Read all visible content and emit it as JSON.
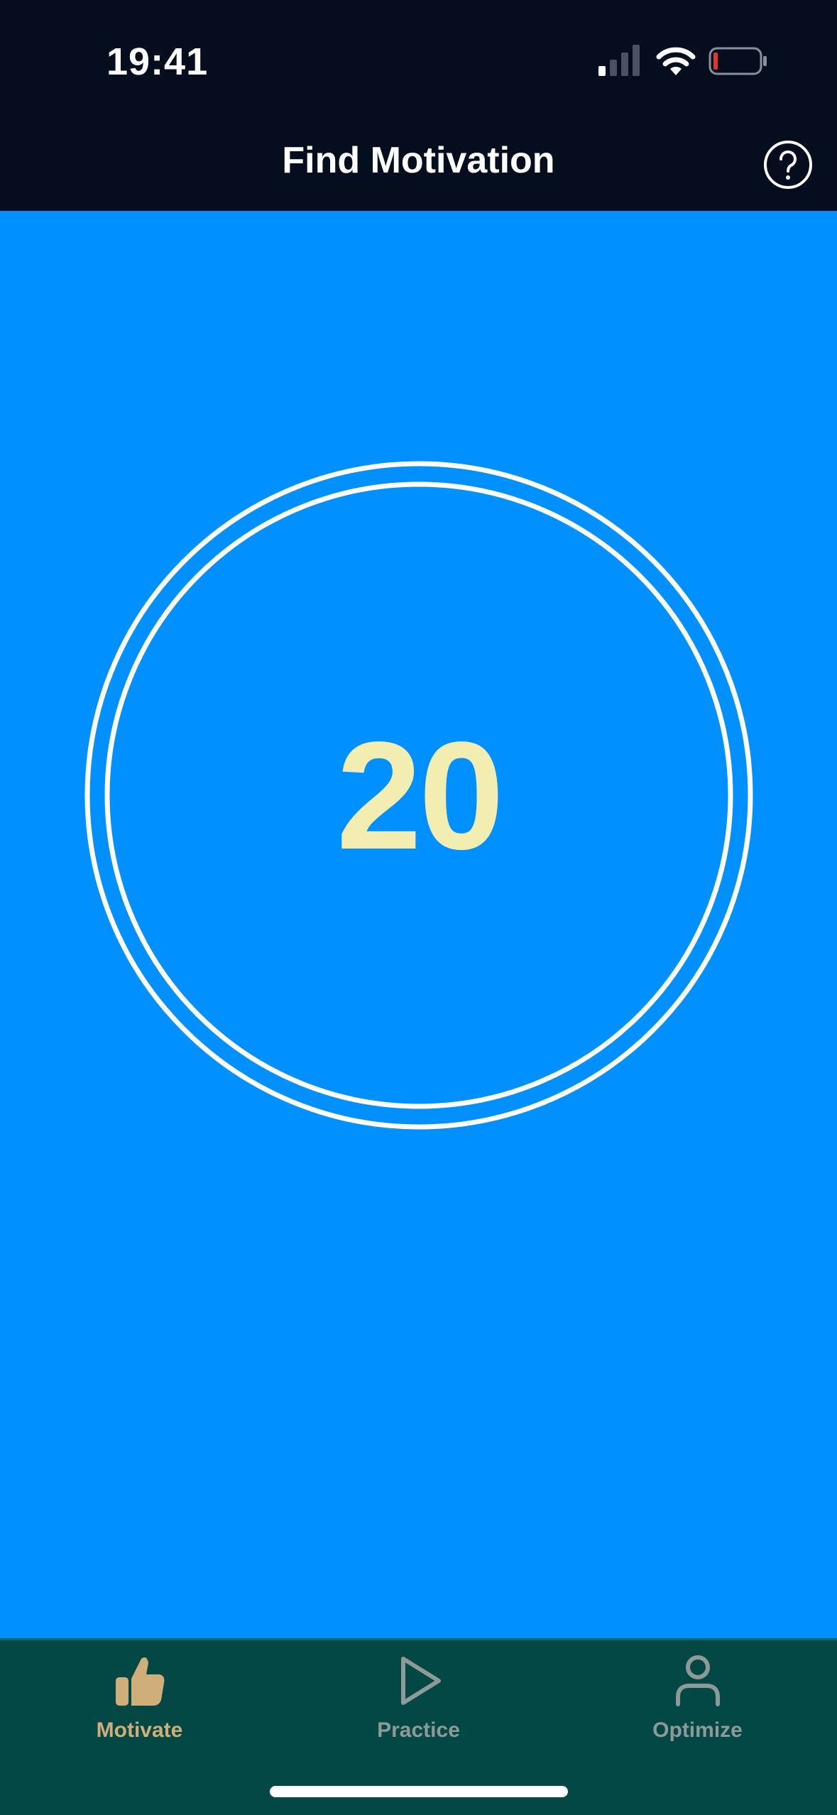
{
  "status_bar": {
    "time": "19:41",
    "icons": [
      "signal-icon",
      "wifi-icon",
      "battery-low-icon"
    ]
  },
  "nav": {
    "title": "Find Motivation",
    "help_icon": "question-circle-icon"
  },
  "counter": {
    "value": "20"
  },
  "tabs": [
    {
      "label": "Motivate",
      "icon": "thumbs-up-icon",
      "active": true
    },
    {
      "label": "Practice",
      "icon": "play-icon",
      "active": false
    },
    {
      "label": "Optimize",
      "icon": "person-icon",
      "active": false
    }
  ],
  "colors": {
    "background": "#0090FF",
    "header": "#050E1E",
    "tabbar": "#034844",
    "counter_text": "#F2EDB0",
    "tab_active": "#CFAE7A",
    "tab_inactive": "#8E9A98",
    "battery_low": "#E5352B"
  }
}
